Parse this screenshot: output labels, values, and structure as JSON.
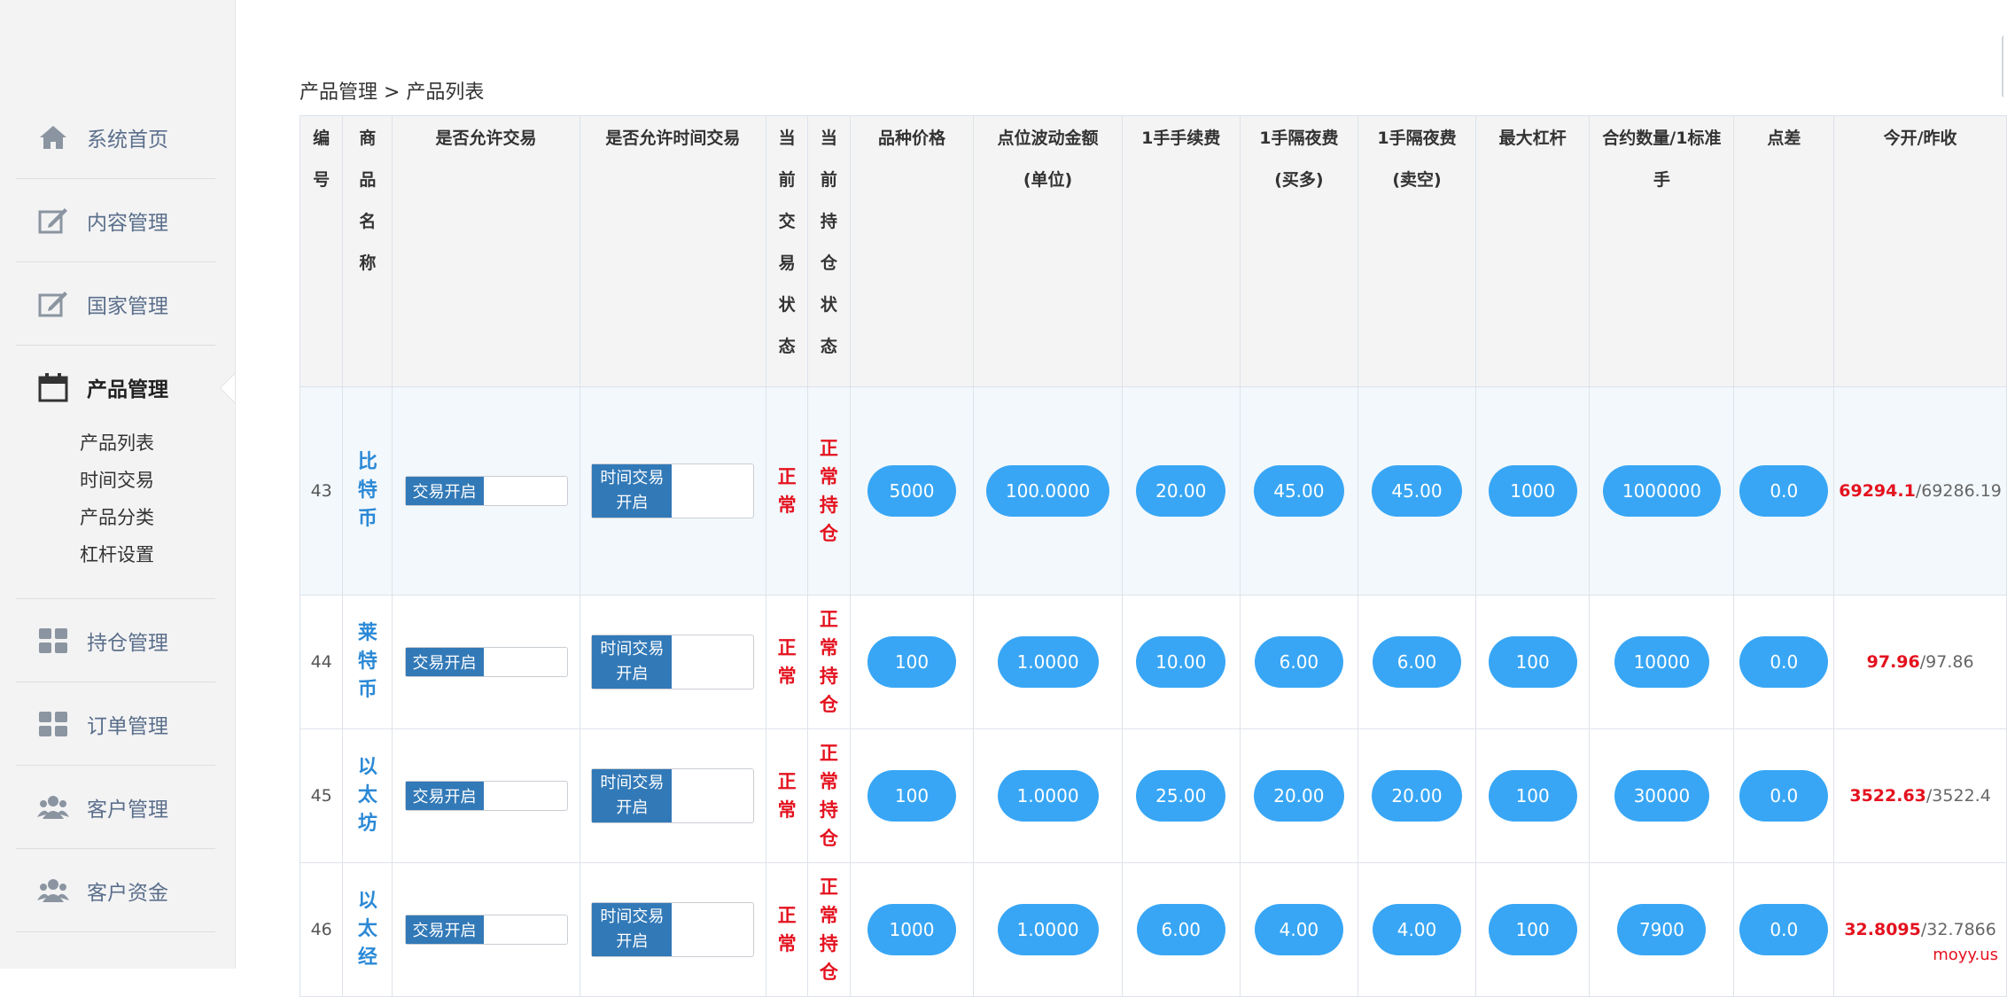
{
  "sidebar": {
    "items": [
      {
        "label": "系统首页",
        "icon": "home-icon"
      },
      {
        "label": "内容管理",
        "icon": "edit-icon"
      },
      {
        "label": "国家管理",
        "icon": "edit-icon"
      },
      {
        "label": "产品管理",
        "icon": "calendar-icon",
        "active": true
      },
      {
        "label": "持仓管理",
        "icon": "grid-icon"
      },
      {
        "label": "订单管理",
        "icon": "grid-icon"
      },
      {
        "label": "客户管理",
        "icon": "users-icon"
      },
      {
        "label": "客户资金",
        "icon": "users-icon"
      }
    ],
    "submenu": [
      "产品列表",
      "时间交易",
      "产品分类",
      "杠杆设置"
    ]
  },
  "breadcrumb": "产品管理 > 产品列表",
  "table": {
    "headers": {
      "id": "编号",
      "name": "商品名称",
      "allow_trade": "是否允许交易",
      "allow_time_trade": "是否允许时间交易",
      "trade_status": "当前交易状态",
      "position_status": "当前持仓状态",
      "price": "品种价格",
      "tick_value": "点位波动金额",
      "tick_value_sub": "(单位)",
      "fee": "1手手续费",
      "overnight_buy": "1手隔夜费",
      "overnight_buy_sub": "(买多)",
      "overnight_sell": "1手隔夜费",
      "overnight_sell_sub": "(卖空)",
      "leverage": "最大杠杆",
      "contract": "合约数量/1标准",
      "contract_sub": "手",
      "spread": "点差",
      "open_close": "今开/昨收"
    },
    "toggle_trade_label": "交易开启",
    "toggle_time_label": "时间交易开启",
    "rows": [
      {
        "id": "43",
        "name": "比特币",
        "trade_status": "正常",
        "position_status": "正常持仓",
        "price": "5000",
        "tick_value": "100.0000",
        "fee": "20.00",
        "overnight_buy": "45.00",
        "overnight_sell": "45.00",
        "leverage": "1000",
        "contract": "1000000",
        "spread": "0.0",
        "open": "69294.1",
        "close": "/69286.19"
      },
      {
        "id": "44",
        "name": "莱特币",
        "trade_status": "正常",
        "position_status": "正常持仓",
        "price": "100",
        "tick_value": "1.0000",
        "fee": "10.00",
        "overnight_buy": "6.00",
        "overnight_sell": "6.00",
        "leverage": "100",
        "contract": "10000",
        "spread": "0.0",
        "open": "97.96",
        "close": "/97.86"
      },
      {
        "id": "45",
        "name": "以太坊",
        "trade_status": "正常",
        "position_status": "正常持仓",
        "price": "100",
        "tick_value": "1.0000",
        "fee": "25.00",
        "overnight_buy": "20.00",
        "overnight_sell": "20.00",
        "leverage": "100",
        "contract": "30000",
        "spread": "0.0",
        "open": "3522.63",
        "close": "/3522.4"
      },
      {
        "id": "46",
        "name": "以太经",
        "trade_status": "正常",
        "position_status": "正常持仓",
        "price": "1000",
        "tick_value": "1.0000",
        "fee": "6.00",
        "overnight_buy": "4.00",
        "overnight_sell": "4.00",
        "leverage": "100",
        "contract": "7900",
        "spread": "0.0",
        "open": "32.8095",
        "close": "/32.7866"
      }
    ]
  },
  "watermark": "moyy.us",
  "colors": {
    "accent": "#38a6f5",
    "toggle": "#3279b7",
    "status_red": "#e4121f",
    "link_blue": "#2b89d6"
  }
}
